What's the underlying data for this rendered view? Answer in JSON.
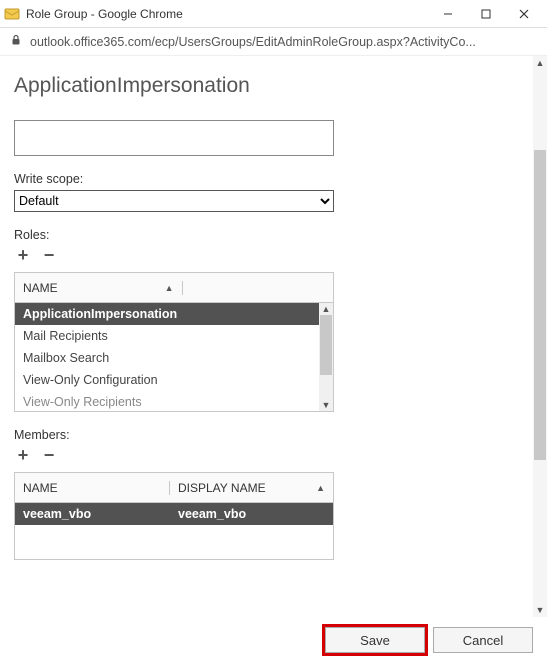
{
  "window": {
    "title": "Role Group - Google Chrome",
    "url": "outlook.office365.com/ecp/UsersGroups/EditAdminRoleGroup.aspx?ActivityCo..."
  },
  "page": {
    "title": "ApplicationImpersonation"
  },
  "write_scope": {
    "label": "Write scope:",
    "value": "Default"
  },
  "roles": {
    "label": "Roles:",
    "header": "NAME",
    "items": [
      {
        "name": "ApplicationImpersonation",
        "selected": true
      },
      {
        "name": "Mail Recipients",
        "selected": false
      },
      {
        "name": "Mailbox Search",
        "selected": false
      },
      {
        "name": "View-Only Configuration",
        "selected": false
      },
      {
        "name": "View-Only Recipients",
        "selected": false,
        "cut": true
      }
    ]
  },
  "members": {
    "label": "Members:",
    "headers": {
      "c1": "NAME",
      "c2": "DISPLAY NAME"
    },
    "items": [
      {
        "name": "veeam_vbo",
        "display": "veeam_vbo",
        "selected": true
      }
    ]
  },
  "footer": {
    "save": "Save",
    "cancel": "Cancel"
  }
}
